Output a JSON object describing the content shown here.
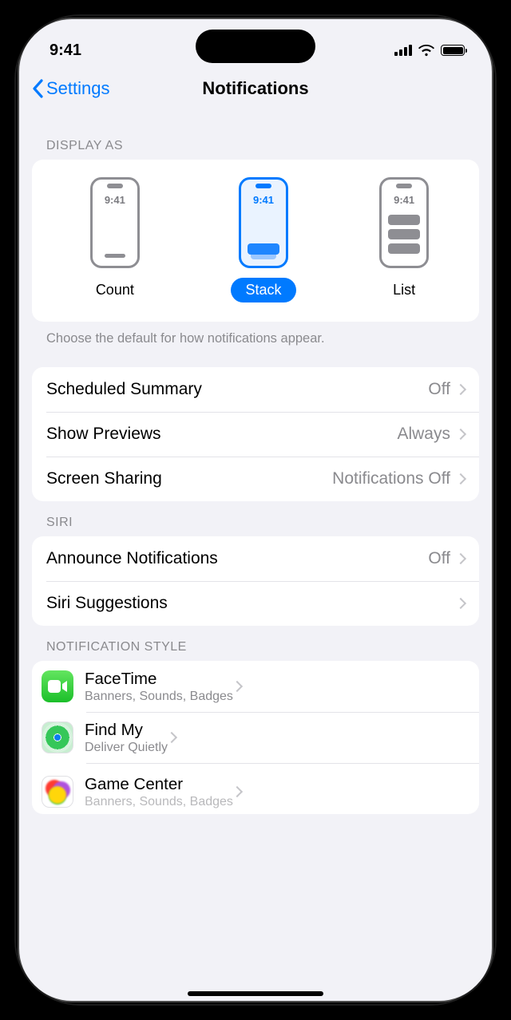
{
  "status": {
    "time": "9:41"
  },
  "nav": {
    "back_label": "Settings",
    "title": "Notifications"
  },
  "display_as": {
    "header": "DISPLAY AS",
    "preview_time": "9:41",
    "options": {
      "count": "Count",
      "stack": "Stack",
      "list": "List"
    },
    "selected": "stack",
    "footer": "Choose the default for how notifications appear."
  },
  "general_rows": [
    {
      "label": "Scheduled Summary",
      "value": "Off"
    },
    {
      "label": "Show Previews",
      "value": "Always"
    },
    {
      "label": "Screen Sharing",
      "value": "Notifications Off"
    }
  ],
  "siri": {
    "header": "SIRI",
    "rows": [
      {
        "label": "Announce Notifications",
        "value": "Off"
      },
      {
        "label": "Siri Suggestions",
        "value": ""
      }
    ]
  },
  "style": {
    "header": "NOTIFICATION STYLE",
    "apps": [
      {
        "name": "FaceTime",
        "sub": "Banners, Sounds, Badges",
        "icon": "facetime"
      },
      {
        "name": "Find My",
        "sub": "Deliver Quietly",
        "icon": "findmy"
      },
      {
        "name": "Game Center",
        "sub": "Banners, Sounds, Badges",
        "icon": "gamecenter"
      }
    ]
  },
  "colors": {
    "accent": "#007aff",
    "bg": "#f2f2f7"
  }
}
